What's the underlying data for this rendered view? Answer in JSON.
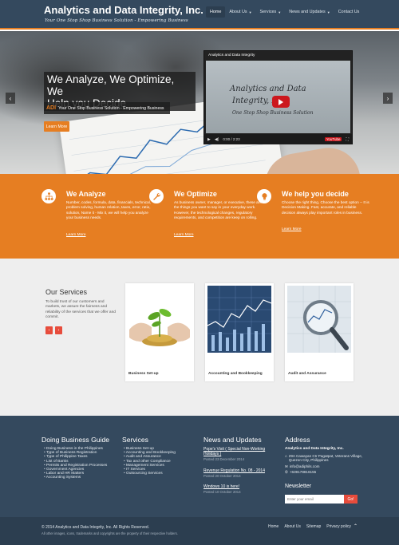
{
  "header": {
    "brand": "Analytics and Data Integrity, Inc.",
    "tagline": "Your One Stop Shop Business Solution - Empowering Business",
    "nav": [
      {
        "label": "Home",
        "active": true,
        "dropdown": false
      },
      {
        "label": "About Us",
        "active": false,
        "dropdown": true
      },
      {
        "label": "Services",
        "active": false,
        "dropdown": true
      },
      {
        "label": "News and Updates",
        "active": false,
        "dropdown": true
      },
      {
        "label": "Contact Us",
        "active": false,
        "dropdown": false
      }
    ],
    "colors": {
      "bar": "#34495e",
      "accent": "#e67e22"
    }
  },
  "hero": {
    "headline_line1": "We Analyze, We Optimize, We",
    "headline_line2": "Help you Decide",
    "sub_logo": "ADI",
    "sub_text": "Your One Stop Business Solution - Empowering Business",
    "button": "Learn More",
    "prev_icon": "chevron-left-icon",
    "next_icon": "chevron-right-icon",
    "video": {
      "title": "Analytics and Data Integrity",
      "screen_line1": "Analytics and Data",
      "screen_line2": "Integrity, Inc.",
      "screen_line3": "One Stop Shop Business Solution",
      "time": "0:00 / 2:23",
      "brand": "YouTube"
    }
  },
  "features": [
    {
      "title": "We Analyze",
      "icon": "sitemap-icon",
      "text": "Number, codes, formula, data, financials, technical, problem solving, human relation, taxes, error, ratio, solution, Name it - Mix it, we will help you analyze your business needs.",
      "link": "Learn More"
    },
    {
      "title": "We Optimize",
      "icon": "wrench-icon",
      "text": "As business owner, manager, or executive, these are the things you want to say in your everyday work. However, the technological changes, regulatory requirements, and competition are keep on rolling.",
      "link": "Learn More"
    },
    {
      "title": "We help you decide",
      "icon": "lightbulb-icon",
      "text": "Choose the right thing, Choose the best option -- It is Decision Making. Fast, accurate, and reliable decision always play important roles in business.",
      "link": "Learn More"
    }
  ],
  "services": {
    "title": "Our Services",
    "description": "To build trust of our customers and markets, we assure the fairness and reliability of the services that we offer and commit.",
    "prev": "‹",
    "next": "›",
    "cards": [
      {
        "label": "Business Set-up",
        "image": "plant-coins-image"
      },
      {
        "label": "Accounting and Bookkeeping",
        "image": "stock-chart-image"
      },
      {
        "label": "Audit and Assurance",
        "image": "magnifier-image"
      }
    ]
  },
  "footer": {
    "guide_title": "Doing Business Guide",
    "guide_items": [
      "Doing Business in the Philippines",
      "Type of Business Registration",
      "Type of Philippine Taxes",
      "List of Banks",
      "Permits and Registration Processes",
      "Government Agencies",
      "Labor and HR Matters",
      "Accounting Systems"
    ],
    "services_title": "Services",
    "services_items": [
      "Business Set-up",
      "Accounting and Bookkeeping",
      "Audit and Assurance",
      "Tax and other Compliance",
      "Management Services",
      "IT Services",
      "Outsourcing Services"
    ],
    "news_title": "News and Updates",
    "news": [
      {
        "title": "Pope's Visit ( Special Non-Working Holidays )",
        "date": "Posted 23 December 2014"
      },
      {
        "title": "Revenue Regulation No. 08 - 2014",
        "date": "Posted 20 October 2014"
      },
      {
        "title": "Windows 10 is here!",
        "date": "Posted 10 October 2014"
      }
    ],
    "address_title": "Address",
    "company": "Analytics and Data Integrity, Inc.",
    "address": "29A Cawayan Ctr Pagatpat, Veterans Village, Quezon City, Philippines",
    "email": "info@adiphils.com",
    "phone": "+639178816155",
    "newsletter_title": "Newsletter",
    "newsletter_placeholder": "Enter your email",
    "newsletter_button": "Go!"
  },
  "bottom": {
    "copyright": "© 2014 Analytics and Data Integrity, Inc. All Rights Reserved.",
    "rights": "All other images, icons, trademarks and copyrights are the property of their respective holders.",
    "links": [
      "Home",
      "About Us",
      "Sitemap",
      "Privacy policy"
    ],
    "to_top_icon": "chevron-up-icon"
  }
}
